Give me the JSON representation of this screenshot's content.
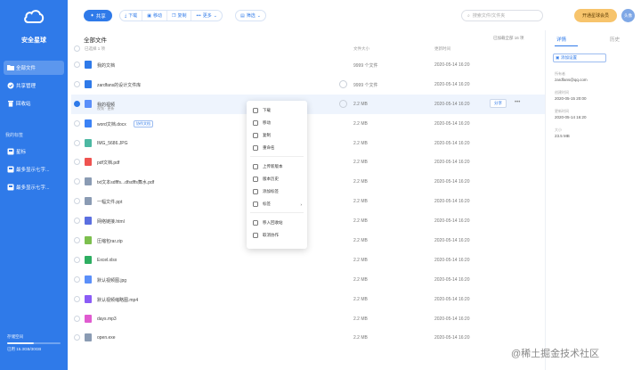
{
  "sidebar": {
    "brand": "安全星球",
    "nav": [
      {
        "label": "全部文件",
        "icon": "folder-icon",
        "active": true
      },
      {
        "label": "共享管理",
        "icon": "share-icon",
        "active": false
      },
      {
        "label": "回收站",
        "icon": "trash-icon",
        "active": false
      }
    ],
    "section_title": "我的标签",
    "tags": [
      {
        "label": "星标",
        "icon": "star-icon"
      },
      {
        "label": "最多显示七字...",
        "icon": "tag-icon"
      },
      {
        "label": "最多显示七字...",
        "icon": "tag-icon"
      }
    ],
    "storage": {
      "label": "存储空间",
      "detail": "已用 15.3GB/30GB",
      "fraction": 0.5
    }
  },
  "toolbar": {
    "new_label": "共享",
    "group1": [
      "下载",
      "移动",
      "复制",
      "更多"
    ],
    "group2": [
      "筛选"
    ],
    "search_placeholder": "搜索文件/文件夹",
    "vip_label": "开通星球会员",
    "avatar_text": "头像"
  },
  "main": {
    "title": "全部文件",
    "count": "已加载全部 16 项",
    "columns": {
      "name": "已选择 1 项",
      "size": "文件大小",
      "date": "更新时间"
    }
  },
  "files": [
    {
      "name": "我的文档",
      "size": "9999 个文件",
      "date": "2020-05-14 16:20",
      "icon": "folder-icon",
      "color": "#2f7ae9",
      "shared": false
    },
    {
      "name": "zardfans的设计文件库",
      "size": "9999 个文件",
      "date": "2020-05-14 16:20",
      "icon": "folder-icon",
      "color": "#2f7ae9",
      "shared": true
    },
    {
      "name": "我的视频",
      "sub": "视频 · 更新",
      "size": "2.2 MB",
      "date": "2020-05-14 16:20",
      "icon": "video-icon",
      "color": "#5b8ff9",
      "shared": true,
      "selected": true
    },
    {
      "name": "word文档.docx",
      "tag": "协作文档",
      "size": "2.2 MB",
      "date": "2020-05-14 16:20",
      "icon": "word-icon",
      "color": "#3b82f6"
    },
    {
      "name": "IMG_5686.JPG",
      "size": "2.2 MB",
      "date": "2020-05-14 16:20",
      "icon": "image-icon",
      "color": "#4cb8a2"
    },
    {
      "name": "pdf文档.pdf",
      "size": "2.2 MB",
      "date": "2020-05-14 16:20",
      "icon": "pdf-icon",
      "color": "#ef5350"
    },
    {
      "name": "txt文本sdfffs...dfsdffs舞水.pdf",
      "size": "2.2 MB",
      "date": "2020-05-14 16:20",
      "icon": "pdf-icon",
      "color": "#8a9bb3"
    },
    {
      "name": "一幅文件.ppt",
      "size": "2.2 MB",
      "date": "2020-05-14 16:20",
      "icon": "ppt-icon",
      "color": "#8a9bb3"
    },
    {
      "name": "网络链接.html",
      "size": "2.2 MB",
      "date": "2020-05-14 16:20",
      "icon": "html-icon",
      "color": "#5b6fe0"
    },
    {
      "name": "压缩包rar.zip",
      "size": "2.2 MB",
      "date": "2020-05-14 16:20",
      "icon": "zip-icon",
      "color": "#7cbf4e"
    },
    {
      "name": "Excel.xlsx",
      "size": "2.2 MB",
      "date": "2020-05-14 16:20",
      "icon": "excel-icon",
      "color": "#2eae61"
    },
    {
      "name": "默认视频图.jpg",
      "size": "2.2 MB",
      "date": "2020-05-14 16:20",
      "icon": "image-icon",
      "color": "#5b8ff9"
    },
    {
      "name": "默认视频缩略图.mp4",
      "size": "2.2 MB",
      "date": "2020-05-14 16:20",
      "icon": "video-icon",
      "color": "#8b5cf6"
    },
    {
      "name": "days.mp3",
      "size": "2.2 MB",
      "date": "2020-05-14 16:20",
      "icon": "audio-icon",
      "color": "#e05bd0"
    },
    {
      "name": "open.exe",
      "size": "2.2 MB",
      "date": "2020-05-14 16:20",
      "icon": "exe-icon",
      "color": "#8a9bb3"
    }
  ],
  "row_actions": {
    "share": "分享",
    "more": "•••"
  },
  "context_menu": [
    {
      "label": "下载",
      "icon": "download-icon"
    },
    {
      "label": "移动",
      "icon": "move-icon"
    },
    {
      "label": "复制",
      "icon": "copy-icon"
    },
    {
      "label": "重命名",
      "icon": "rename-icon"
    },
    {
      "label": "上传新版本",
      "icon": "upload-icon"
    },
    {
      "label": "版本历史",
      "icon": "history-icon"
    },
    {
      "label": "添加标签",
      "icon": "tag-icon"
    },
    {
      "label": "标签",
      "icon": "label-icon",
      "submenu": true
    },
    {
      "label": "移入回收站",
      "icon": "trash-icon"
    },
    {
      "label": "取消协作",
      "icon": "cancel-icon"
    }
  ],
  "right_panel": {
    "tabs": [
      "详情",
      "历史"
    ],
    "button": "添加设置",
    "fields": [
      {
        "label": "所有者",
        "value": "zardfans@qq.com"
      },
      {
        "label": "创建时间",
        "value": "2020-05-15 20:00"
      },
      {
        "label": "更新时间",
        "value": "2020-05-14 16:20"
      },
      {
        "label": "大小",
        "value": "23.5 MB"
      }
    ]
  },
  "watermark": "@稀土掘金技术社区",
  "colors": {
    "primary": "#2f7ae9",
    "vip": "#f7c46c"
  }
}
